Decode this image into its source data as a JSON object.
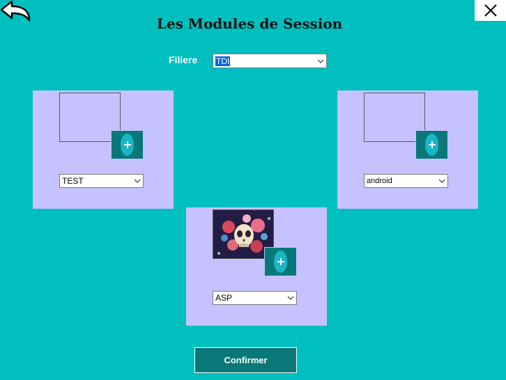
{
  "window": {
    "title": "Les Modules de Session",
    "back_icon": "back-arrow-icon",
    "close_icon": "close-icon"
  },
  "filiere": {
    "label": "Filiere",
    "selected": "TDI"
  },
  "modules": [
    {
      "selected": "TEST",
      "image": "empty",
      "add_icon": "plus-icon"
    },
    {
      "selected": "android",
      "image": "empty",
      "add_icon": "plus-icon"
    },
    {
      "selected": "ASP",
      "image": "skull-with-flowers",
      "add_icon": "plus-icon"
    }
  ],
  "confirm_label": "Confirmer",
  "colors": {
    "background": "#00bfbf",
    "panel": "#c6c2ff",
    "button": "#087878",
    "add_oval": "#19b6c6"
  }
}
